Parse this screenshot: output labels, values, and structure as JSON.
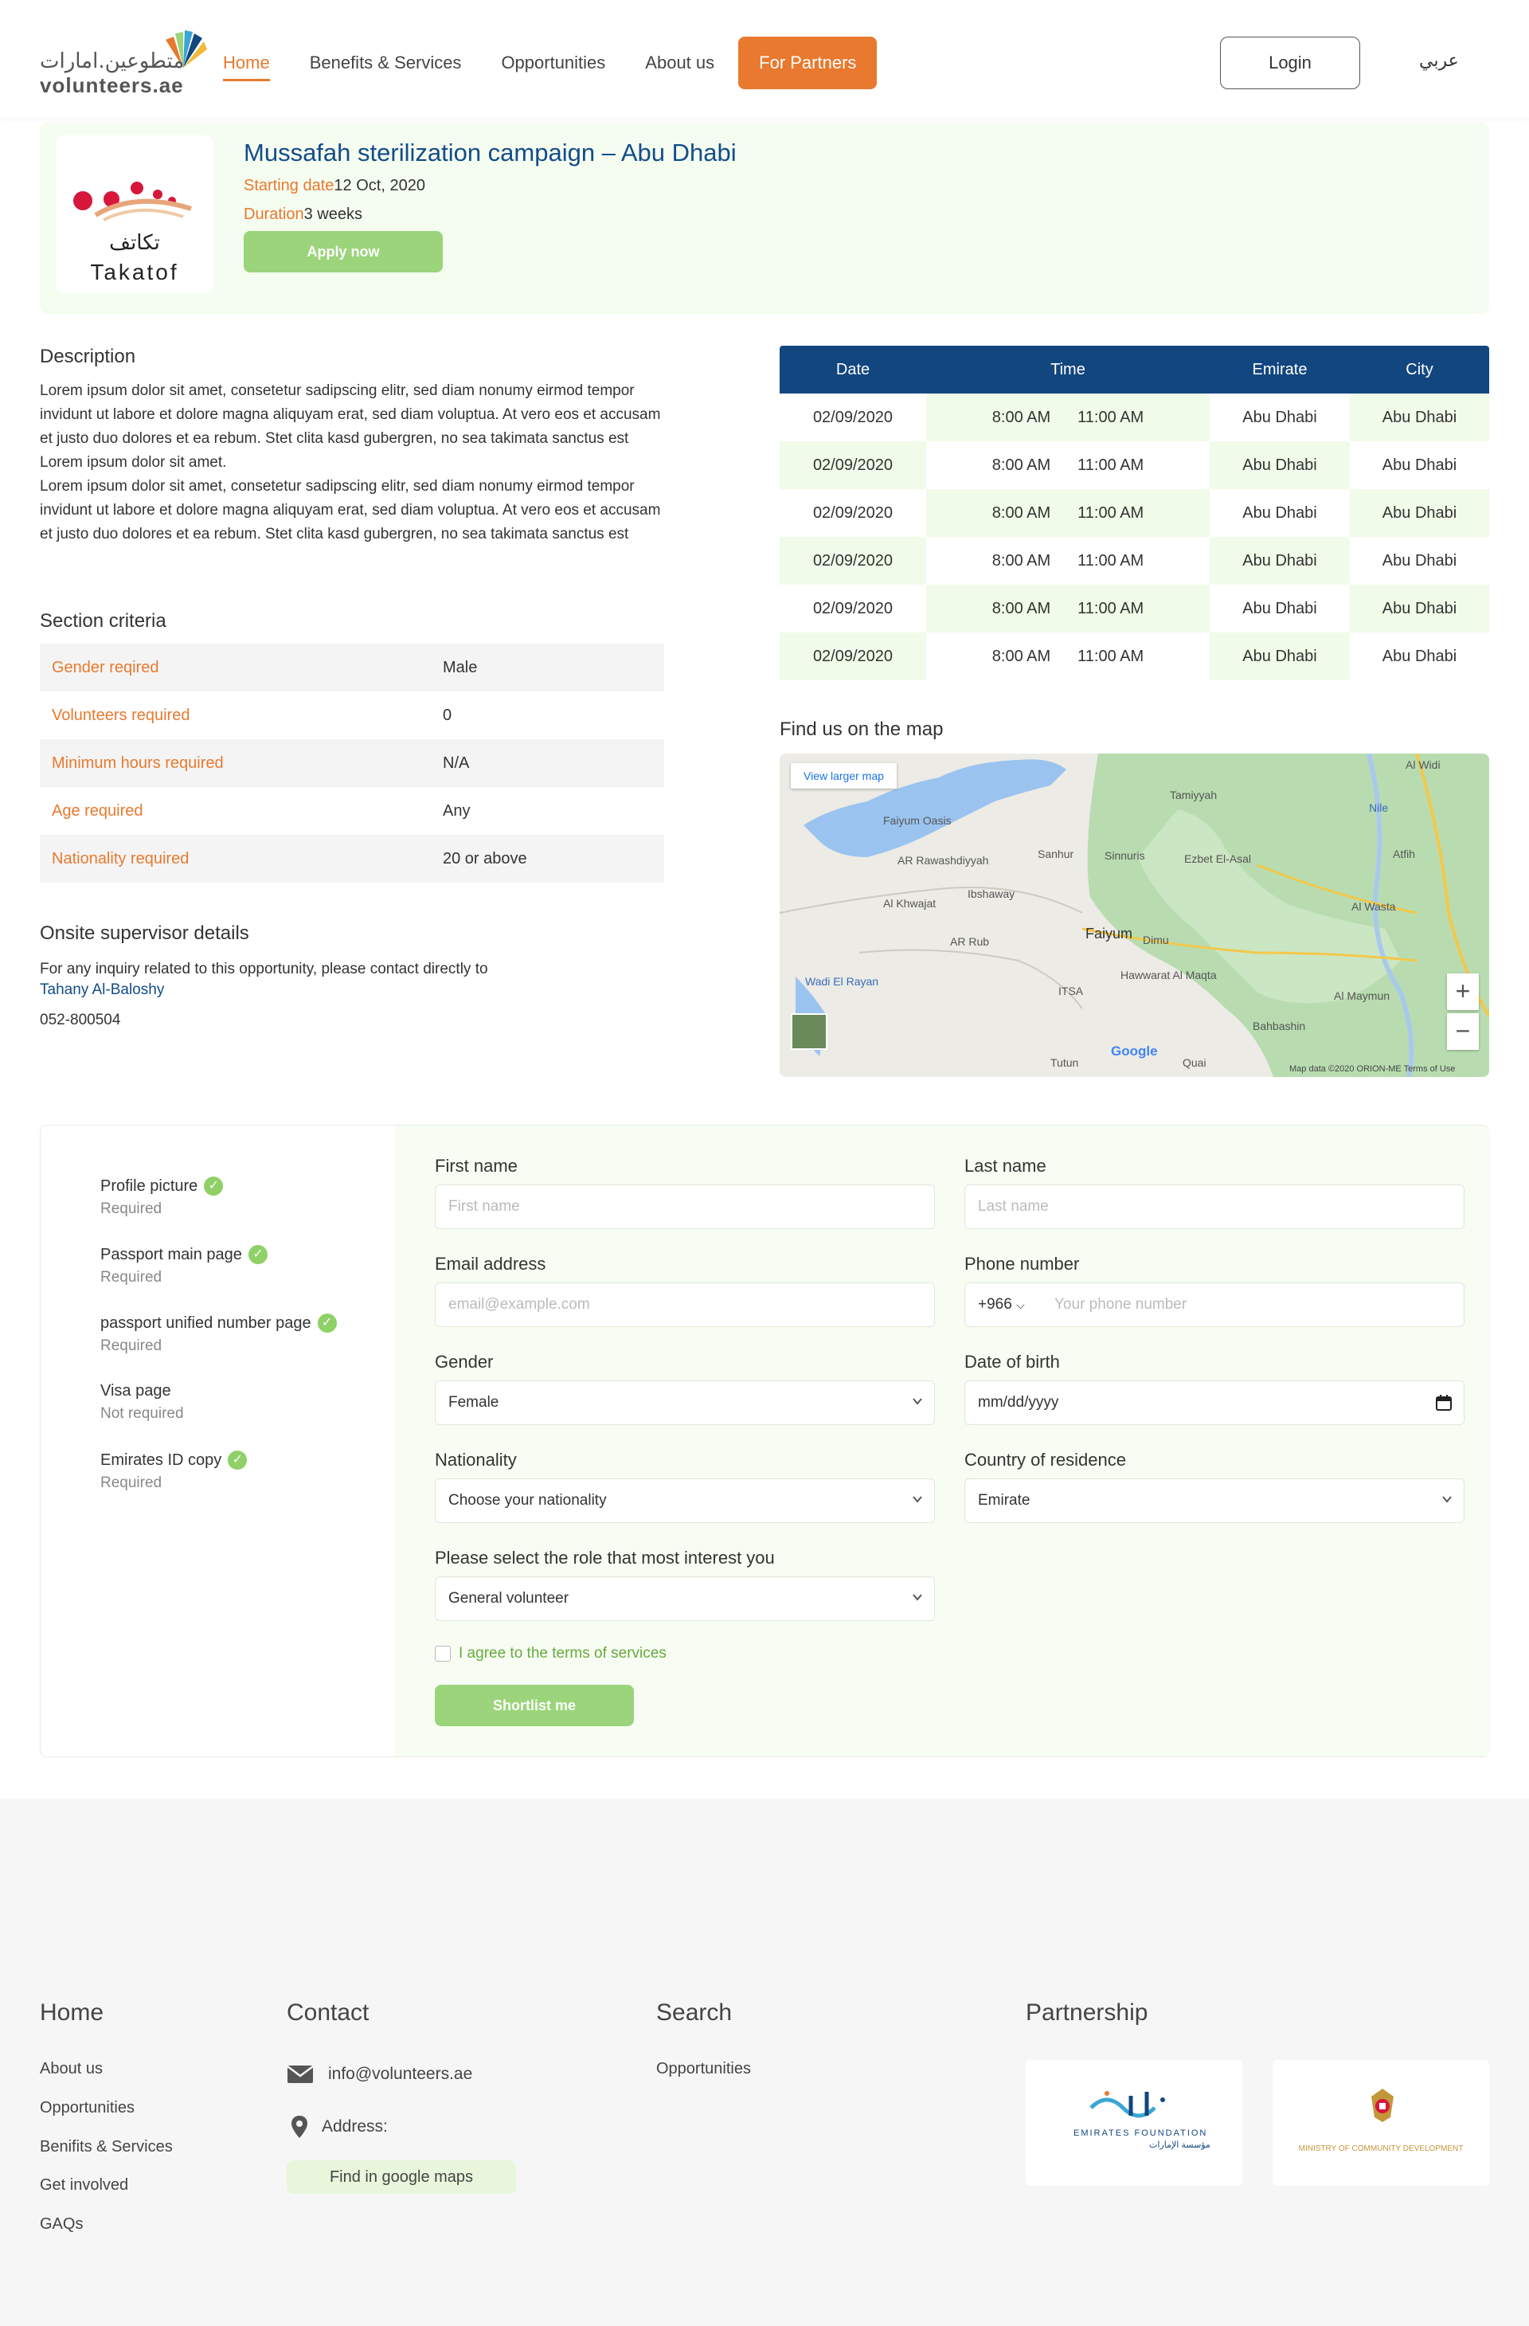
{
  "header": {
    "logo_ar": "متطوعين.امارات",
    "logo_en": "volunteers.ae",
    "nav": [
      "Home",
      "Benefits & Services",
      "Opportunities",
      "About us"
    ],
    "partners": "For Partners",
    "login": "Login",
    "lang": "عربي"
  },
  "hero": {
    "org_ar": "تكاتف",
    "org_en": "Takatof",
    "title": "Mussafah sterilization campaign – Abu Dhabi",
    "start_label": "Starting date",
    "start_value": "12 Oct, 2020",
    "duration_label": "Duration",
    "duration_value": "3 weeks",
    "apply": "Apply now"
  },
  "description": {
    "title": "Description",
    "text1": "Lorem ipsum dolor sit amet, consetetur sadipscing elitr, sed diam nonumy eirmod tempor invidunt ut labore et dolore magna aliquyam erat, sed diam voluptua. At vero eos et accusam et justo duo dolores et ea rebum. Stet clita kasd gubergren, no sea takimata sanctus est Lorem ipsum dolor sit amet.",
    "text2": "Lorem ipsum dolor sit amet, consetetur sadipscing elitr, sed diam nonumy eirmod tempor invidunt ut labore et dolore magna aliquyam erat, sed diam voluptua. At vero eos et accusam et justo duo dolores et ea rebum. Stet clita kasd gubergren, no sea takimata sanctus est"
  },
  "criteria": {
    "title": "Section criteria",
    "rows": [
      {
        "key": "Gender reqired",
        "value": "Male"
      },
      {
        "key": "Volunteers required",
        "value": "0"
      },
      {
        "key": "Minimum hours required",
        "value": "N/A"
      },
      {
        "key": "Age required",
        "value": "Any"
      },
      {
        "key": "Nationality required",
        "value": "20 or above"
      }
    ]
  },
  "supervisor": {
    "title": "Onsite supervisor details",
    "text": "For any inquiry related to this opportunity, please contact directly to",
    "name": "Tahany Al-Baloshy",
    "phone": "052-800504"
  },
  "schedule": {
    "headers": [
      "Date",
      "Time",
      "Emirate",
      "City"
    ],
    "rows": [
      {
        "date": "02/09/2020",
        "from": "8:00 AM",
        "to": "11:00 AM",
        "emirate": "Abu Dhabi",
        "city": "Abu Dhabi"
      },
      {
        "date": "02/09/2020",
        "from": "8:00 AM",
        "to": "11:00 AM",
        "emirate": "Abu Dhabi",
        "city": "Abu Dhabi"
      },
      {
        "date": "02/09/2020",
        "from": "8:00 AM",
        "to": "11:00 AM",
        "emirate": "Abu Dhabi",
        "city": "Abu Dhabi"
      },
      {
        "date": "02/09/2020",
        "from": "8:00 AM",
        "to": "11:00 AM",
        "emirate": "Abu Dhabi",
        "city": "Abu Dhabi"
      },
      {
        "date": "02/09/2020",
        "from": "8:00 AM",
        "to": "11:00 AM",
        "emirate": "Abu Dhabi",
        "city": "Abu Dhabi"
      },
      {
        "date": "02/09/2020",
        "from": "8:00 AM",
        "to": "11:00 AM",
        "emirate": "Abu Dhabi",
        "city": "Abu Dhabi"
      }
    ]
  },
  "map": {
    "title": "Find us on the map",
    "view_larger": "View larger map",
    "zoom_in": "+",
    "zoom_out": "−",
    "google": "Google",
    "attribution": "Map data ©2020 ORION-ME   Terms of Use",
    "labels": [
      "Faiyum Oasis",
      "AR Rawashdiyyah",
      "Sanhur",
      "Sinnuris",
      "Tamiyyah",
      "Ezbet El-Asal",
      "Al Khwajat",
      "Ibshaway",
      "AR Rub",
      "Faiyum",
      "Dimu",
      "Hawwarat Al Maqta",
      "Wadi El Rayan",
      "ITSA",
      "Tutun",
      "Quai",
      "Bahbashin",
      "Al Maymun",
      "Al Wasta",
      "Atfih",
      "Al Widi",
      "Nile"
    ]
  },
  "documents": [
    {
      "name": "Profile picture",
      "status": "Required",
      "done": true
    },
    {
      "name": "Passport main page",
      "status": "Required",
      "done": true
    },
    {
      "name": "passport unified number page",
      "status": "Required",
      "done": true
    },
    {
      "name": "Visa page",
      "status": "Not required",
      "done": false
    },
    {
      "name": "Emirates ID copy",
      "status": "Required",
      "done": true
    }
  ],
  "form": {
    "first_name_label": "First name",
    "first_name_ph": "First name",
    "last_name_label": "Last name",
    "last_name_ph": "Last name",
    "email_label": "Email address",
    "email_ph": "email@example.com",
    "phone_label": "Phone number",
    "phone_code": "+966",
    "phone_ph": "Your phone number",
    "gender_label": "Gender",
    "gender_value": "Female",
    "dob_label": "Date of birth",
    "dob_value": "mm/dd/yyyy",
    "nationality_label": "Nationality",
    "nationality_value": "Choose your nationality",
    "country_label": "Country of residence",
    "country_value": "Emirate",
    "role_label": "Please select the role that most interest you",
    "role_value": "General volunteer",
    "agree": "I agree to the terms of services",
    "submit": "Shortlist me"
  },
  "footer": {
    "home_title": "Home",
    "home_links": [
      "About us",
      "Opportunities",
      "Benifits & Services",
      "Get involved",
      "GAQs"
    ],
    "contact_title": "Contact",
    "email": "info@volunteers.ae",
    "address": "Address:",
    "gmaps": "Find in google maps",
    "search_title": "Search",
    "search_links": [
      "Opportunities"
    ],
    "partnership_title": "Partnership",
    "partner1_ar": "مؤسسة الإمارات",
    "partner1_en": "EMIRATES FOUNDATION",
    "partner2_en": "MINISTRY OF COMMUNITY DEVELOPMENT"
  },
  "colors": {
    "accent": "#e8792e",
    "navy": "#12467f",
    "green": "#9bd47a",
    "light_green": "#f5fdf0"
  }
}
